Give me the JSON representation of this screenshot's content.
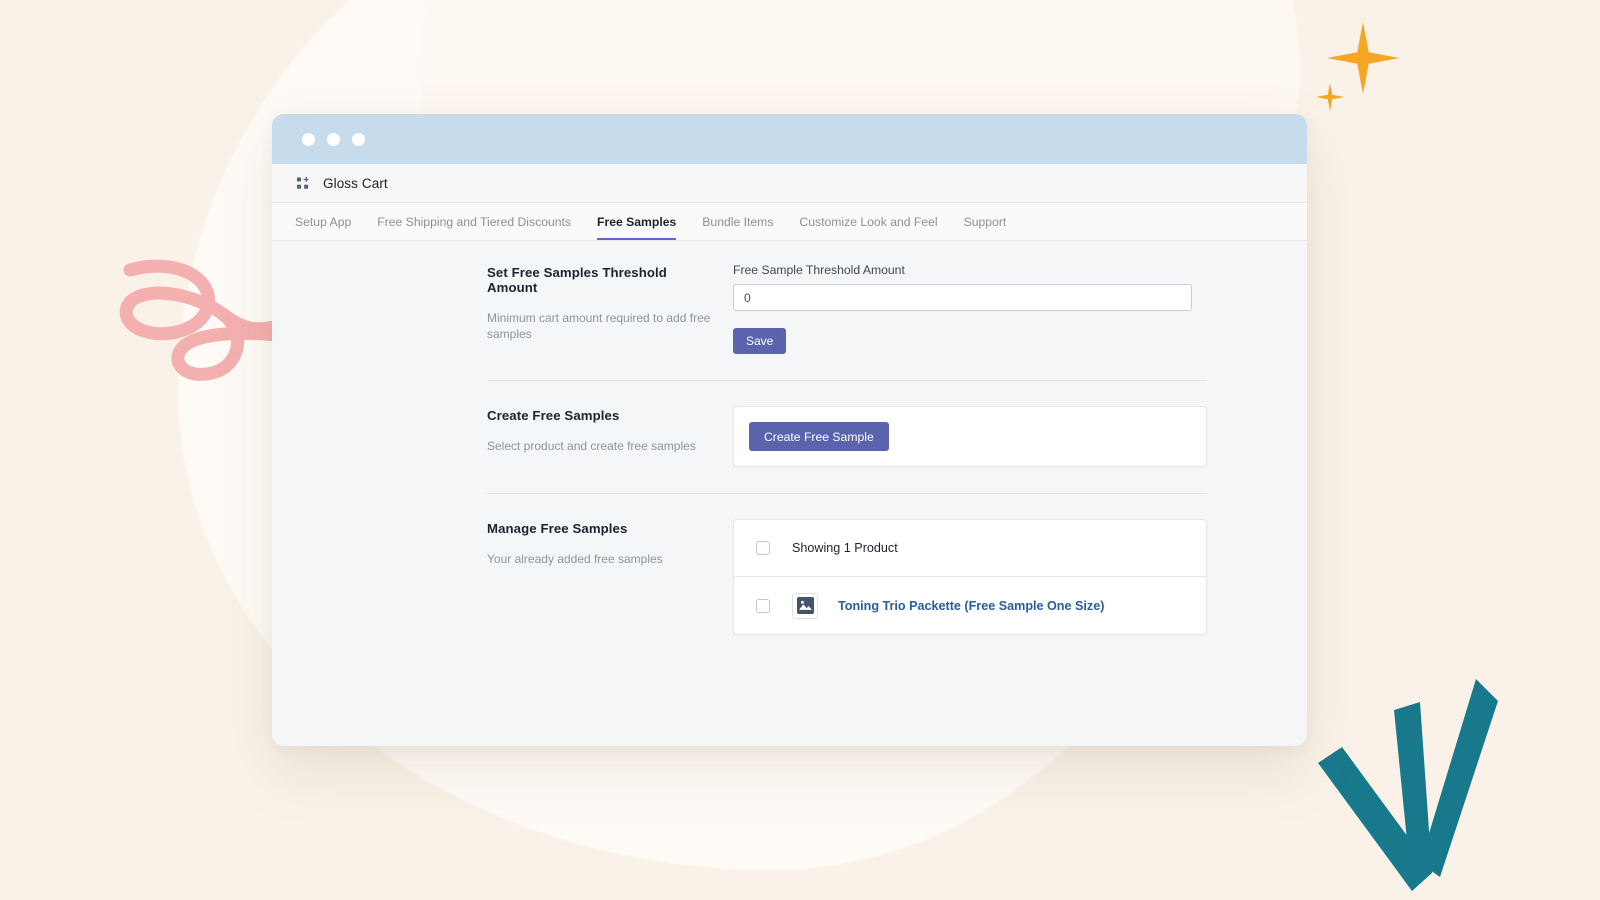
{
  "window": {
    "dots": [
      "window-dot-1",
      "window-dot-2",
      "window-dot-3"
    ],
    "app_title": "Gloss Cart",
    "app_icon": "apps-grid-icon"
  },
  "tabs": [
    {
      "label": "Setup App",
      "active": false
    },
    {
      "label": "Free Shipping and Tiered Discounts",
      "active": false
    },
    {
      "label": "Free Samples",
      "active": true
    },
    {
      "label": "Bundle Items",
      "active": false
    },
    {
      "label": "Customize Look and Feel",
      "active": false
    },
    {
      "label": "Support",
      "active": false
    }
  ],
  "sections": {
    "threshold": {
      "title": "Set Free Samples Threshold Amount",
      "description": "Minimum cart amount required to add free samples",
      "field_label": "Free Sample Threshold Amount",
      "field_value": "0",
      "field_placeholder": "0",
      "save_label": "Save"
    },
    "create": {
      "title": "Create Free Samples",
      "description": "Select product and create free samples",
      "button_label": "Create Free Sample"
    },
    "manage": {
      "title": "Manage Free Samples",
      "description": "Your already added free samples",
      "showing_label": "Showing 1 Product",
      "products": [
        {
          "name": "Toning Trio Packette (Free Sample One Size)",
          "thumbnail_icon": "image-placeholder-icon",
          "selected": false
        }
      ],
      "select_all_checked": false
    }
  },
  "colors": {
    "page_background": "#faf2e8",
    "titlebar": "#c6dced",
    "accent_primary": "#5c63ad",
    "tab_active_underline": "#5c6ac4",
    "link": "#2a5d9b",
    "sparkle": "#f5a623",
    "squiggle": "#f4afaf",
    "burst": "#19798c"
  },
  "decorations": [
    {
      "name": "orange-sparkle-large"
    },
    {
      "name": "orange-sparkle-small"
    },
    {
      "name": "pink-squiggle"
    },
    {
      "name": "teal-burst"
    },
    {
      "name": "cream-blob"
    }
  ]
}
